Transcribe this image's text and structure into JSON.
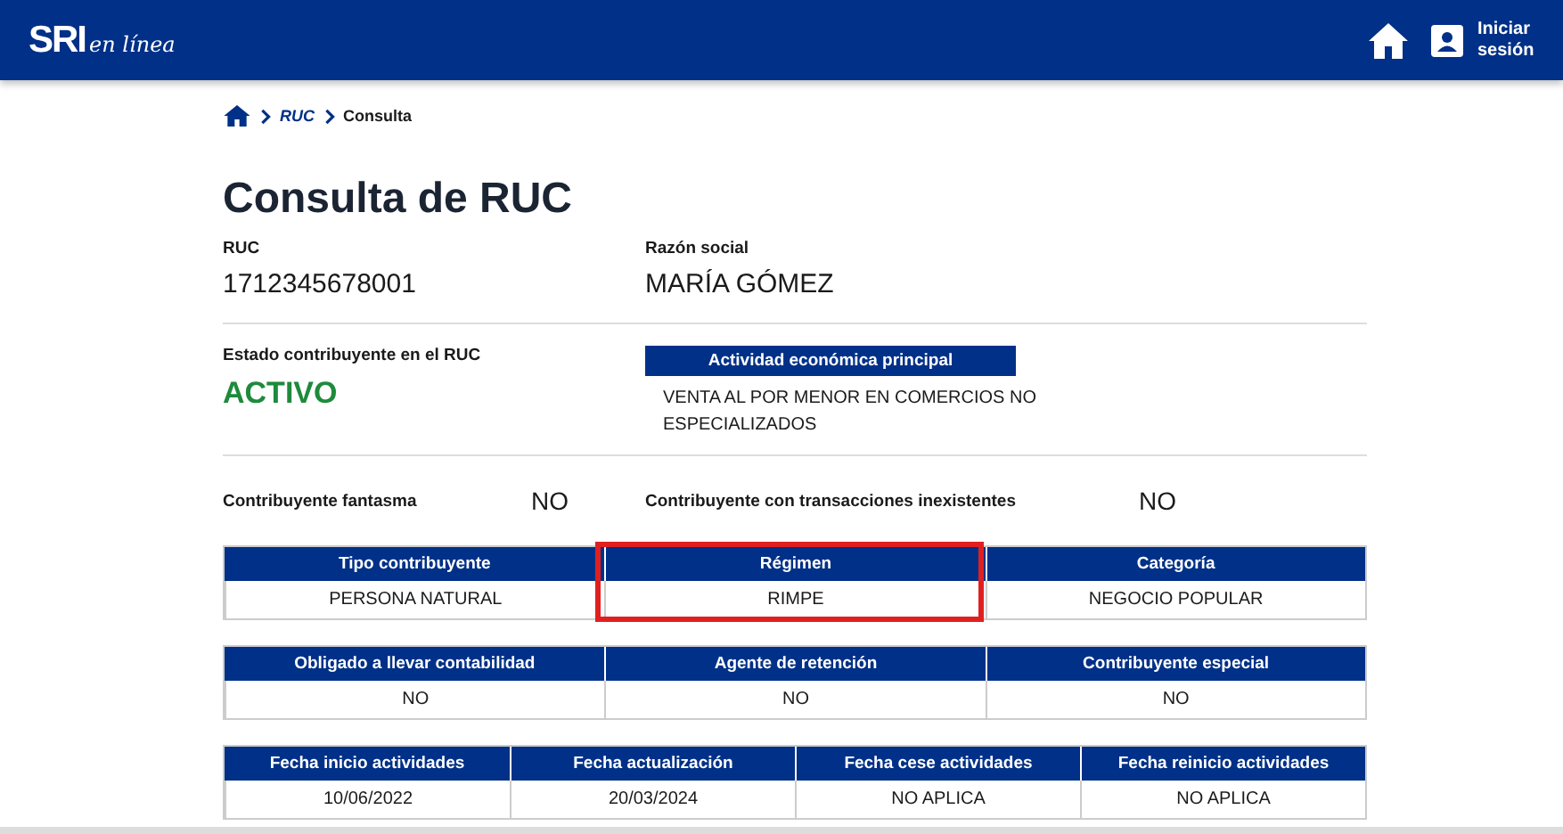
{
  "header": {
    "logo": {
      "brand": "SRI",
      "tagline": "en línea"
    },
    "login": "Iniciar sesión"
  },
  "breadcrumb": [
    {
      "label": "RUC",
      "link": true
    },
    {
      "label": "Consulta",
      "link": false
    }
  ],
  "title": "Consulta de RUC",
  "ruc": {
    "label": "RUC",
    "value": "1712345678001"
  },
  "razon_social": {
    "label": "Razón social",
    "value": "MARÍA GÓMEZ"
  },
  "estado": {
    "label": "Estado contribuyente en el RUC",
    "value": "ACTIVO",
    "color": "#1e8a3c"
  },
  "actividad": {
    "label": "Actividad económica principal",
    "value": "VENTA AL POR MENOR EN COMERCIOS NO ESPECIALIZADOS"
  },
  "flags": [
    {
      "label": "Contribuyente fantasma",
      "value": "NO"
    },
    {
      "label": "Contribuyente con transacciones inexistentes",
      "value": "NO"
    }
  ],
  "tables": [
    {
      "cells": [
        {
          "header": "Tipo contribuyente",
          "value": "PERSONA NATURAL",
          "highlighted": false
        },
        {
          "header": "Régimen",
          "value": "RIMPE",
          "highlighted": true
        },
        {
          "header": "Categoría",
          "value": "NEGOCIO POPULAR",
          "highlighted": false
        }
      ]
    },
    {
      "cells": [
        {
          "header": "Obligado a llevar contabilidad",
          "value": "NO",
          "highlighted": false
        },
        {
          "header": "Agente de retención",
          "value": "NO",
          "highlighted": false
        },
        {
          "header": "Contribuyente especial",
          "value": "NO",
          "highlighted": false
        }
      ]
    },
    {
      "cells": [
        {
          "header": "Fecha inicio actividades",
          "value": "10/06/2022",
          "highlighted": false
        },
        {
          "header": "Fecha actualización",
          "value": "20/03/2024",
          "highlighted": false
        },
        {
          "header": "Fecha cese actividades",
          "value": "NO APLICA",
          "highlighted": false
        },
        {
          "header": "Fecha reinicio actividades",
          "value": "NO APLICA",
          "highlighted": false
        }
      ]
    }
  ]
}
